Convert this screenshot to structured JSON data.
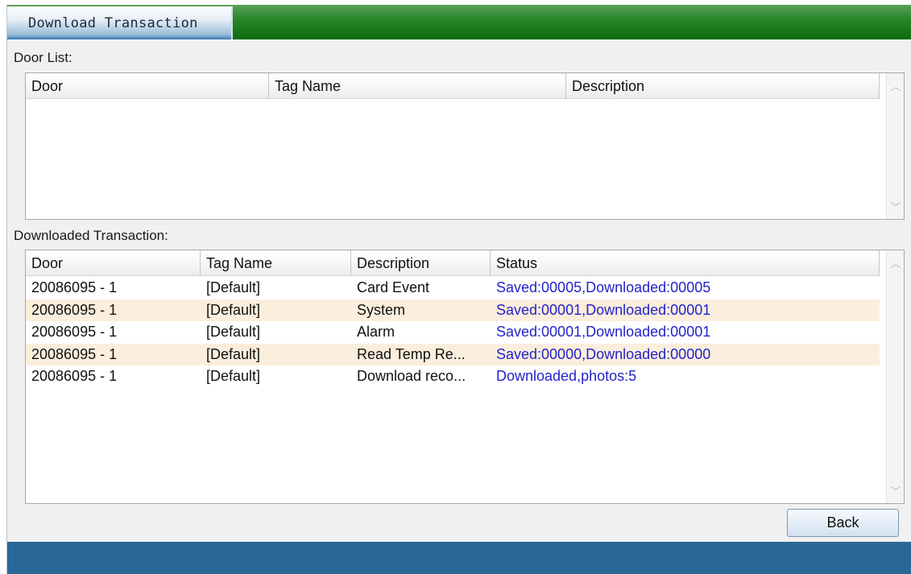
{
  "window": {
    "title": "Download Transaction"
  },
  "door_list": {
    "label": "Door List:",
    "columns": [
      "Door",
      "Tag Name",
      "Description"
    ],
    "rows": []
  },
  "downloaded": {
    "label": "Downloaded Transaction:",
    "columns": [
      "Door",
      "Tag Name",
      "Description",
      "Status"
    ],
    "rows": [
      [
        "20086095 - 1",
        "[Default]",
        "Card Event",
        "Saved:00005,Downloaded:00005"
      ],
      [
        "20086095 - 1",
        "[Default]",
        "System",
        "Saved:00001,Downloaded:00001"
      ],
      [
        "20086095 - 1",
        "[Default]",
        "Alarm",
        "Saved:00001,Downloaded:00001"
      ],
      [
        "20086095 - 1",
        "[Default]",
        "Read Temp Re...",
        "Saved:00000,Downloaded:00000"
      ],
      [
        "20086095 - 1",
        "[Default]",
        "Download reco...",
        "Downloaded,photos:5"
      ]
    ]
  },
  "buttons": {
    "back": "Back"
  },
  "icons": {
    "scroll_up": "chevron-up-icon",
    "scroll_down": "chevron-down-icon"
  },
  "colors": {
    "title_bar": "#1a7a1a",
    "footer": "#2a6696",
    "status_text": "#2323c8",
    "alt_row": "#fbeedd"
  }
}
